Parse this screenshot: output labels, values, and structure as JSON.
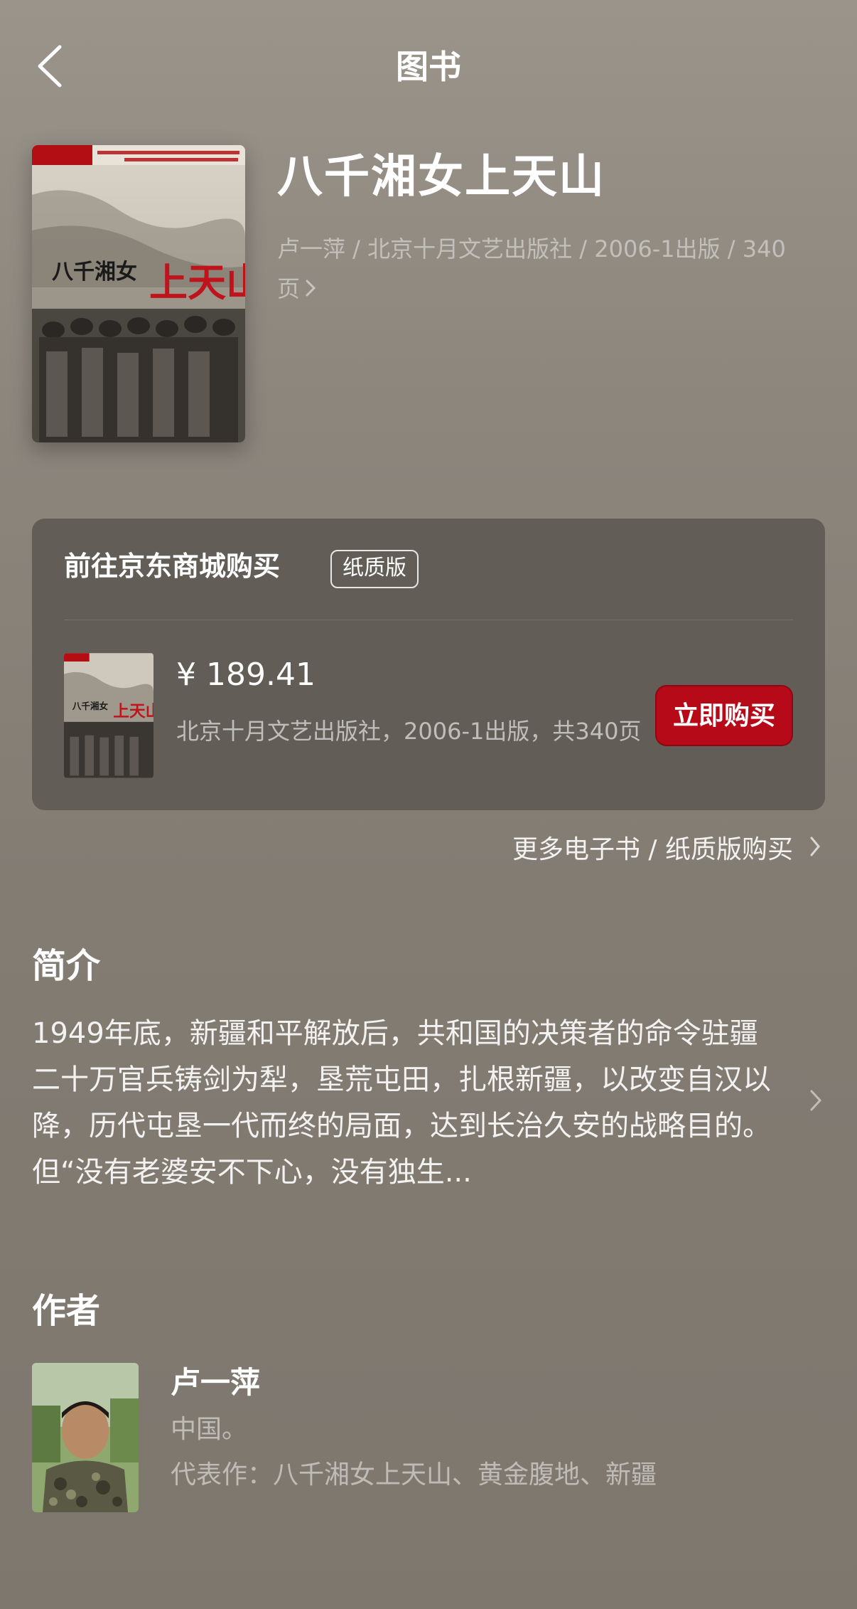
{
  "nav": {
    "title": "图书",
    "back_icon": "chevron-left-icon"
  },
  "book": {
    "title": "八千湘女上天山",
    "meta": "卢一萍 / 北京十月文艺出版社 / 2006-1出版 / 340 页",
    "cover_title": "八千湘女上天山"
  },
  "purchase": {
    "title": "前往京东商城购买",
    "badge": "纸质版",
    "price": "¥ 189.41",
    "edition_info": "北京十月文艺出版社，2006-1出版，共340页",
    "buy_label": "立即购买",
    "buy_color": "#b70a18"
  },
  "more_link": "更多电子书 / 纸质版购买",
  "intro": {
    "heading": "简介",
    "text": "1949年底，新疆和平解放后，共和国的决策者的命令驻疆二十万官兵铸剑为犁，垦荒屯田，扎根新疆，以改变自汉以降，历代屯垦一代而终的局面，达到长治久安的战略目的。但“没有老婆安不下心，没有独生..."
  },
  "author": {
    "heading": "作者",
    "name": "卢一萍",
    "origin": "中国。",
    "works": "代表作：八千湘女上天山、黄金腹地、新疆"
  }
}
